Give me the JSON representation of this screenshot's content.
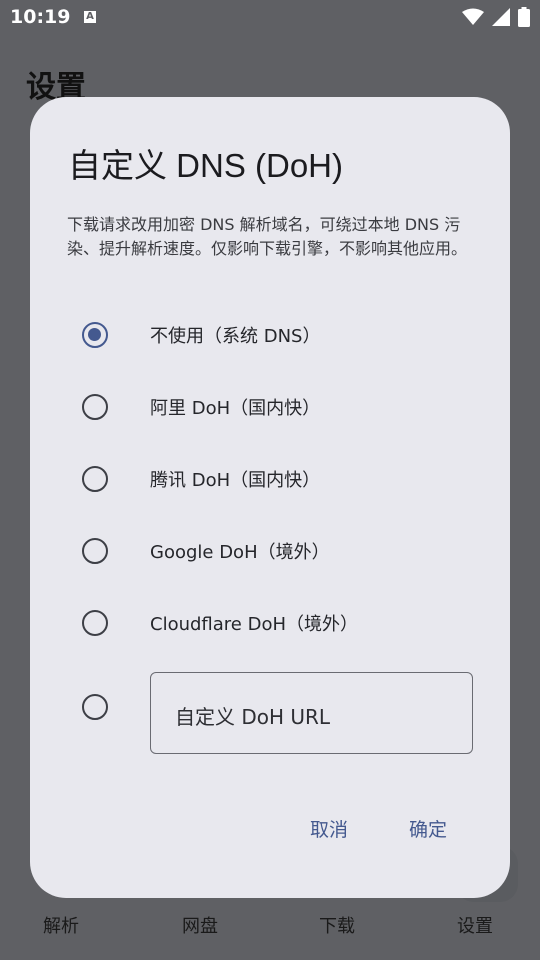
{
  "status_bar": {
    "time": "10:19",
    "notification_icon_letter": "A",
    "icons": [
      "wifi-icon",
      "signal-icon",
      "battery-icon"
    ]
  },
  "background": {
    "page_title": "设置",
    "bottom_nav": [
      "解析",
      "网盘",
      "下载",
      "设置"
    ]
  },
  "dialog": {
    "title": "自定义 DNS (DoH)",
    "description": "下载请求改用加密 DNS 解析域名，可绕过本地 DNS 污染、提升解析速度。仅影响下载引擎，不影响其他应用。",
    "options": [
      {
        "label": "不使用（系统 DNS）",
        "selected": true
      },
      {
        "label": "阿里 DoH（国内快）",
        "selected": false
      },
      {
        "label": "腾讯 DoH（国内快）",
        "selected": false
      },
      {
        "label": "Google DoH（境外）",
        "selected": false
      },
      {
        "label": "Cloudflare DoH（境外）",
        "selected": false
      }
    ],
    "custom_option": {
      "selected": false,
      "placeholder": "自定义 DoH URL",
      "value": ""
    },
    "cancel_label": "取消",
    "confirm_label": "确定"
  },
  "colors": {
    "accent": "#44598f",
    "dialog_bg": "#e8e8ee",
    "scrim": "#5f6064"
  }
}
